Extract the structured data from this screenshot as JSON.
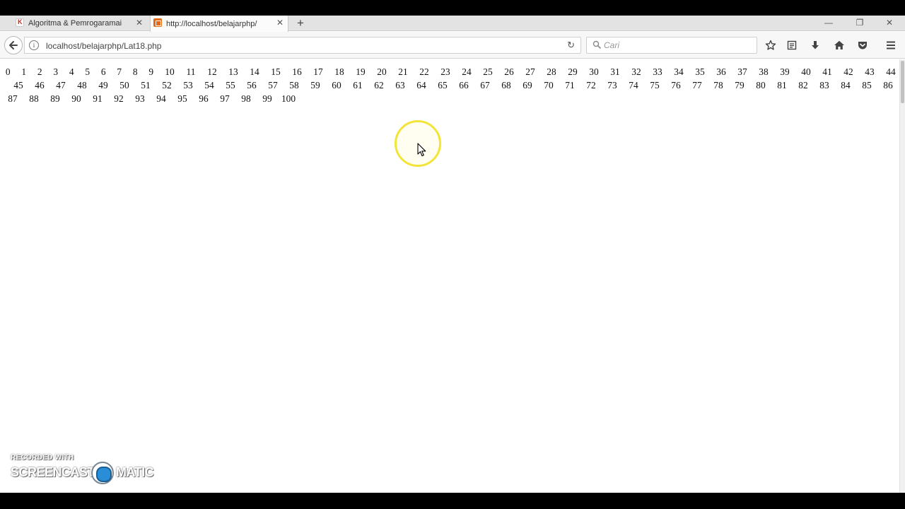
{
  "browser": {
    "tabs": [
      {
        "title": "Algoritma & Pemrogaramai",
        "active": false,
        "favicon": "kompas-k-icon"
      },
      {
        "title": "http://localhost/belajarphp/",
        "active": true,
        "favicon": "xampp-icon"
      }
    ],
    "new_tab_label": "+",
    "address": "localhost/belajarphp/Lat18.php",
    "search_placeholder": "Cari",
    "window_controls": {
      "minimize": "—",
      "maximize": "❐",
      "close": "✕"
    }
  },
  "page": {
    "rows": [
      [
        "0",
        "1",
        "2",
        "3",
        "4",
        "5",
        "6",
        "7",
        "8",
        "9",
        "10",
        "11",
        "12",
        "13",
        "14",
        "15",
        "16",
        "17",
        "18",
        "19",
        "20",
        "21",
        "22",
        "23",
        "24",
        "25",
        "26",
        "27",
        "28",
        "29",
        "30",
        "31",
        "32",
        "33",
        "34",
        "35",
        "36",
        "37",
        "38",
        "39",
        "40",
        "41",
        "42",
        "43",
        "44"
      ],
      [
        "45",
        "46",
        "47",
        "48",
        "49",
        "50",
        "51",
        "52",
        "53",
        "54",
        "55",
        "56",
        "57",
        "58",
        "59",
        "60",
        "61",
        "62",
        "63",
        "64",
        "65",
        "66",
        "67",
        "68",
        "69",
        "70",
        "71",
        "72",
        "73",
        "74",
        "75",
        "76",
        "77",
        "78",
        "79",
        "80",
        "81",
        "82",
        "83",
        "84",
        "85",
        "86"
      ],
      [
        "87",
        "88",
        "89",
        "90",
        "91",
        "92",
        "93",
        "94",
        "95",
        "96",
        "97",
        "98",
        "99",
        "100"
      ]
    ]
  },
  "watermark": {
    "recorded_with": "RECORDED WITH",
    "brand_left": "SCREENCAST",
    "brand_right": "MATIC"
  },
  "colors": {
    "cursor_highlight": "#f3e43a",
    "tab_strip": "#e3e3e3",
    "active_tab": "#fbfbfb"
  }
}
